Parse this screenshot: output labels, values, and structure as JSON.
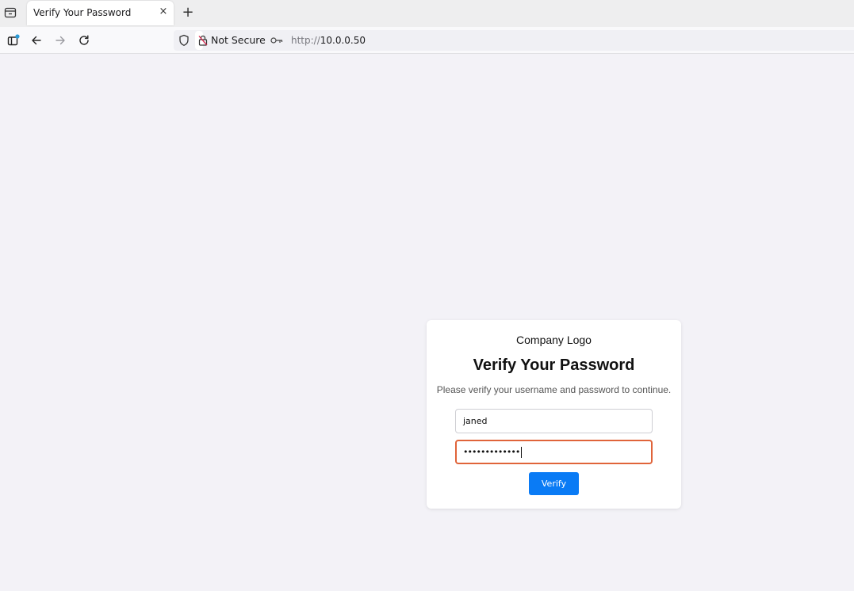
{
  "browser": {
    "tab": {
      "title": "Verify Your Password",
      "close_glyph": "×"
    },
    "new_tab_glyph": "+",
    "security_label": "Not Secure",
    "url": {
      "protocol": "http://",
      "host": "10.0.0.50"
    },
    "icons": [
      "tab-list-icon",
      "sidebar-icon",
      "back-icon",
      "forward-icon",
      "reload-icon",
      "shield-icon",
      "insecure-lock-icon",
      "key-icon"
    ]
  },
  "page": {
    "logo_text": "Company Logo",
    "heading": "Verify Your Password",
    "subtitle": "Please verify your username and password to continue.",
    "username_value": "janed",
    "password_value": "•••••••••••••",
    "verify_label": "Verify",
    "colors": {
      "accent": "#0a7bf5",
      "focus_border": "#e0643a",
      "background": "#f3f2f7"
    }
  }
}
